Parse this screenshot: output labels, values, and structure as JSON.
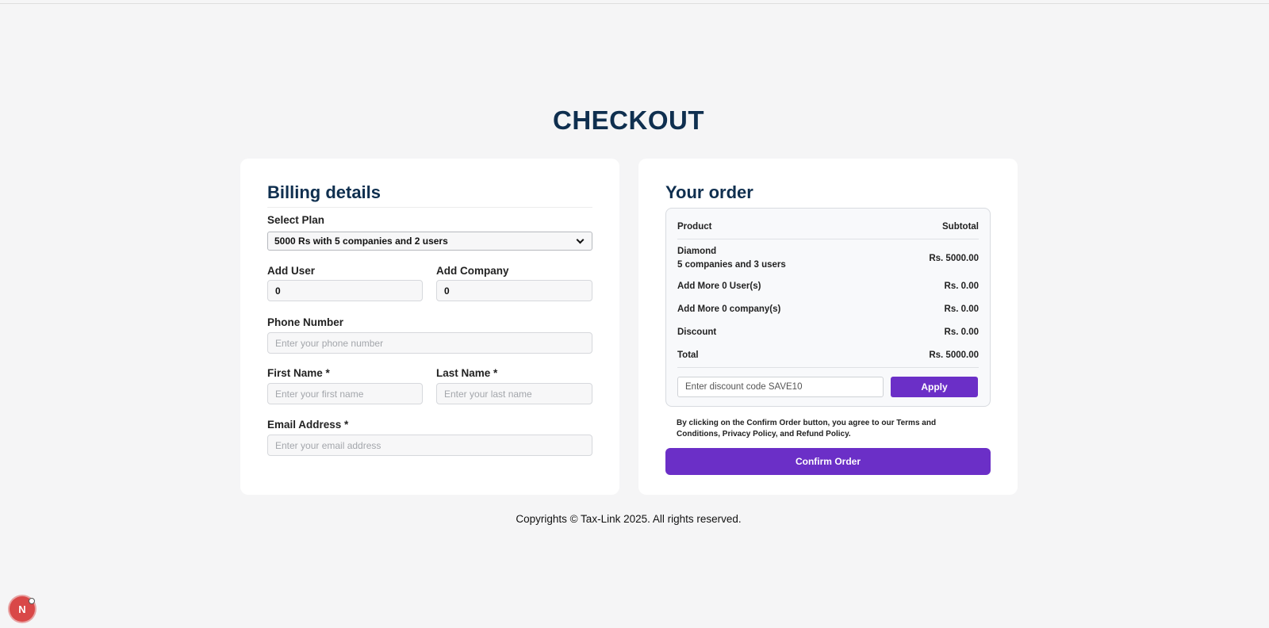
{
  "page": {
    "title": "CHECKOUT",
    "footer": "Copyrights © Tax-Link 2025. All rights reserved.",
    "badge_letter": "N"
  },
  "billing": {
    "heading": "Billing details",
    "select_plan_label": "Select Plan",
    "select_plan_value": "5000 Rs with 5 companies and 2 users",
    "add_user_label": "Add User",
    "add_user_value": "0",
    "add_company_label": "Add Company",
    "add_company_value": "0",
    "phone_label": "Phone Number",
    "phone_placeholder": "Enter your phone number",
    "first_name_label": "First Name *",
    "first_name_placeholder": "Enter your first name",
    "last_name_label": "Last Name *",
    "last_name_placeholder": "Enter your last name",
    "email_label": "Email Address *",
    "email_placeholder": "Enter your email address"
  },
  "order": {
    "heading": "Your order",
    "header_product": "Product",
    "header_subtotal": "Subtotal",
    "rows": [
      {
        "label": "Diamond",
        "sublabel": "5 companies and 3 users",
        "value": "Rs. 5000.00"
      },
      {
        "label": "Add More 0 User(s)",
        "value": "Rs. 0.00"
      },
      {
        "label": "Add More 0 company(s)",
        "value": "Rs. 0.00"
      },
      {
        "label": "Discount",
        "value": "Rs. 0.00"
      },
      {
        "label": "Total",
        "value": "Rs. 5000.00"
      }
    ],
    "discount_placeholder": "Enter discount code SAVE10",
    "apply_label": "Apply",
    "terms": "By clicking on the Confirm Order button, you agree to our Terms and Conditions, Privacy Policy, and Refund Policy.",
    "confirm_label": "Confirm Order"
  },
  "colors": {
    "heading": "#0f2f4f",
    "accent": "#6b2fc7",
    "background": "#f5f5f6"
  }
}
